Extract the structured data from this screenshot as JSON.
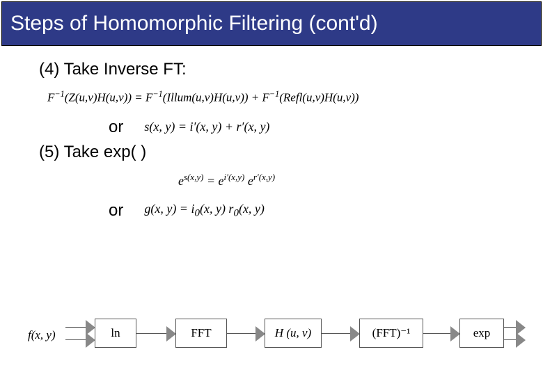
{
  "title": "Steps of Homomorphic Filtering (cont'd)",
  "step4": {
    "label": "(4) Take Inverse FT:",
    "equation_html": "F<sup>−1</sup>(Z(u,v)H(u,v)) = F<sup>−1</sup>(Illum(u,v)H(u,v)) + F<sup>−1</sup>(Refl(u,v)H(u,v))",
    "or": "or",
    "alt_equation_html": "s(x, y) = i′(x, y) + r′(x, y)"
  },
  "step5": {
    "label": "(5) Take exp( )",
    "equation_html": "e<sup>s(x,y)</sup> = e<sup>i′(x,y)</sup> e<sup>r′(x,y)</sup>",
    "or": "or",
    "alt_equation_html": "g(x, y) = i<sub>0</sub>(x, y) r<sub>0</sub>(x, y)"
  },
  "pipeline": {
    "input": "f(x, y)",
    "stages": [
      "ln",
      "FFT",
      "H (u, v)",
      "(FFT)⁻¹",
      "exp"
    ]
  }
}
